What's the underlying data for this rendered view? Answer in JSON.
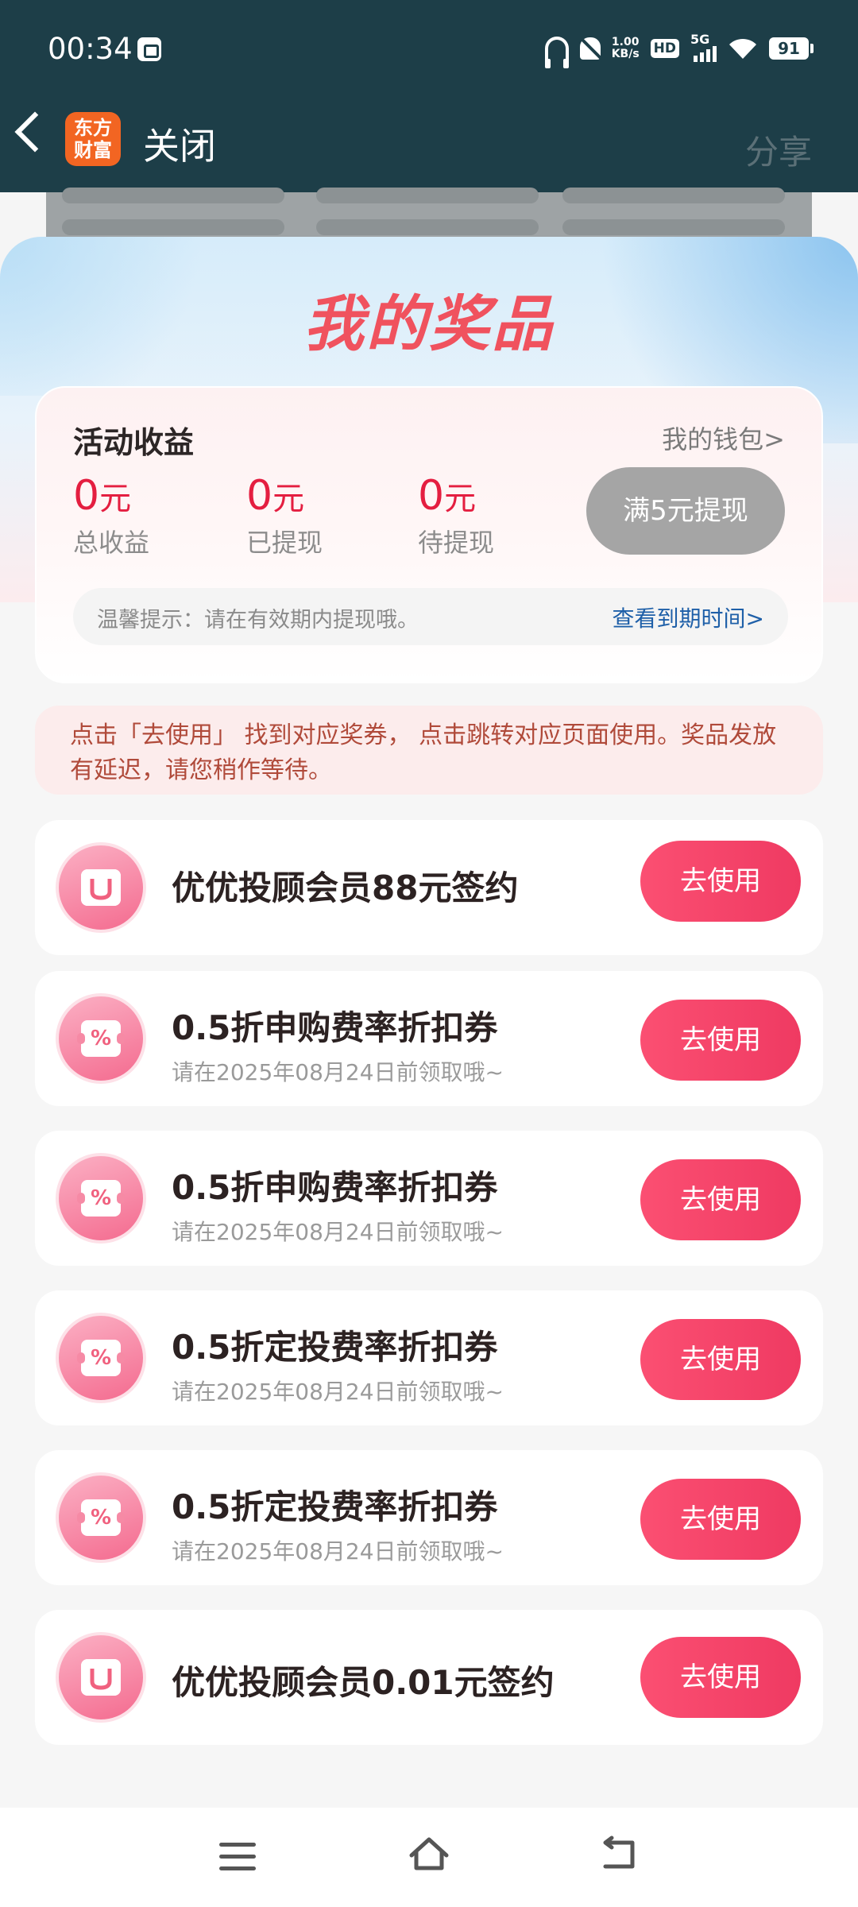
{
  "status_bar": {
    "time": "00:34",
    "net_speed_value": "1.00",
    "net_speed_unit": "KB/s",
    "hd": "HD",
    "signal": "5G",
    "battery": "91"
  },
  "header": {
    "logo_line1": "东方",
    "logo_line2": "财富",
    "close": "关闭",
    "share": "分享"
  },
  "page_title": "我的奖品",
  "earnings": {
    "title": "活动收益",
    "wallet_link": "我的钱包>",
    "stats": [
      {
        "value": "0",
        "unit": "元",
        "label": "总收益"
      },
      {
        "value": "0",
        "unit": "元",
        "label": "已提现"
      },
      {
        "value": "0",
        "unit": "元",
        "label": "待提现"
      }
    ],
    "withdraw_button": "满5元提现",
    "tip": "温馨提示：请在有效期内提现哦。",
    "expiry_link": "查看到期时间>"
  },
  "notice": "点击「去使用」 找到对应奖券， 点击跳转对应页面使用。奖品发放有延迟，请您稍作等待。",
  "prizes": [
    {
      "title": "优优投顾会员88元签约",
      "subtitle": "",
      "icon": "member-icon",
      "button": "去使用"
    },
    {
      "title": "0.5折申购费率折扣券",
      "subtitle": "请在2025年08月24日前领取哦~",
      "icon": "coupon-icon",
      "button": "去使用"
    },
    {
      "title": "0.5折申购费率折扣券",
      "subtitle": "请在2025年08月24日前领取哦~",
      "icon": "coupon-icon",
      "button": "去使用"
    },
    {
      "title": "0.5折定投费率折扣券",
      "subtitle": "请在2025年08月24日前领取哦~",
      "icon": "coupon-icon",
      "button": "去使用"
    },
    {
      "title": "0.5折定投费率折扣券",
      "subtitle": "请在2025年08月24日前领取哦~",
      "icon": "coupon-icon",
      "button": "去使用"
    },
    {
      "title": "优优投顾会员0.01元签约",
      "subtitle": "",
      "icon": "member-icon",
      "button": "去使用"
    }
  ],
  "coupon_symbol": "%",
  "colors": {
    "header_bg": "#1d3e48",
    "accent_red": "#e41e40",
    "button_pink": "#f54468",
    "disabled_gray": "#a5a5a5",
    "link_blue": "#1e5fa8"
  }
}
